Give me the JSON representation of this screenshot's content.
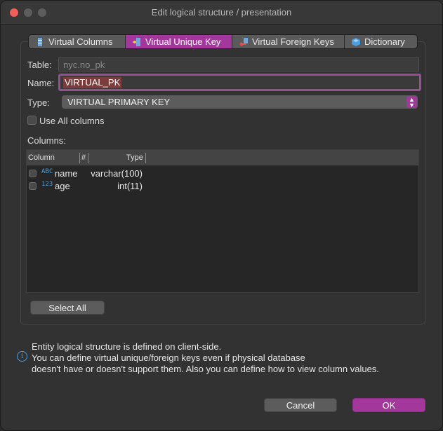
{
  "window": {
    "title": "Edit logical structure / presentation"
  },
  "tabs": [
    {
      "label": "Virtual Columns",
      "icon": "virtual-columns-icon",
      "active": false
    },
    {
      "label": "Virtual Unique Key",
      "icon": "unique-key-icon",
      "active": true
    },
    {
      "label": "Virtual Foreign Keys",
      "icon": "foreign-keys-icon",
      "active": false
    },
    {
      "label": "Dictionary",
      "icon": "dictionary-icon",
      "active": false
    }
  ],
  "form": {
    "table_label": "Table:",
    "table_value": "nyc.no_pk",
    "name_label": "Name:",
    "name_value": "VIRTUAL_PK",
    "type_label": "Type:",
    "type_value": "VIRTUAL PRIMARY KEY",
    "use_all_label": "Use All columns",
    "columns_label": "Columns:"
  },
  "grid": {
    "headers": {
      "column": "Column",
      "num": "#",
      "type": "Type"
    },
    "rows": [
      {
        "icon": "ABC",
        "name": "name",
        "type": "varchar(100)",
        "checked": false
      },
      {
        "icon": "123",
        "name": "age",
        "type": "int(11)",
        "checked": false
      }
    ]
  },
  "buttons": {
    "select_all": "Select All",
    "cancel": "Cancel",
    "ok": "OK"
  },
  "info": {
    "line1": "Entity logical structure is defined on client-side.",
    "line2": "You can define virtual unique/foreign keys even if physical database",
    "line3": "doesn't have or doesn't support them. Also you can define how to view column values."
  },
  "colors": {
    "accent": "#a4379c",
    "close": "#ee5f58",
    "info": "#4a9fe0"
  }
}
